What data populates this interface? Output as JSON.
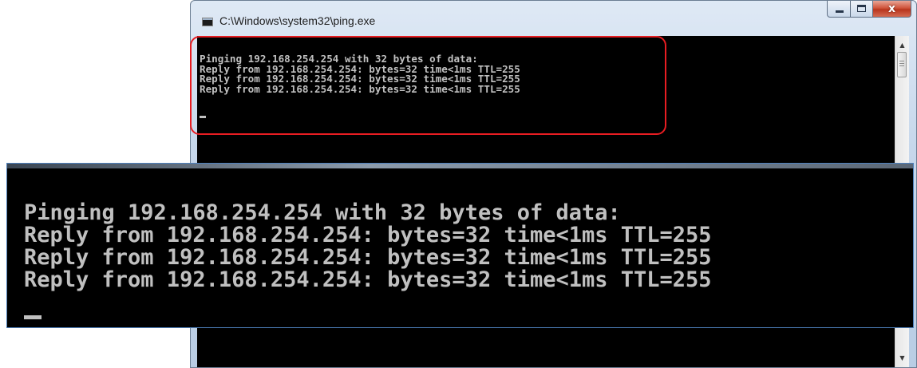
{
  "window": {
    "title": "C:\\Windows\\system32\\ping.exe",
    "close_glyph": "x",
    "buttons": [
      "minimize",
      "maximize",
      "close"
    ]
  },
  "console": {
    "lines": [
      "Pinging 192.168.254.254 with 32 bytes of data:",
      "Reply from 192.168.254.254: bytes=32 time<1ms TTL=255",
      "Reply from 192.168.254.254: bytes=32 time<1ms TTL=255",
      "Reply from 192.168.254.254: bytes=32 time<1ms TTL=255"
    ]
  },
  "zoom": {
    "lines": [
      "Pinging 192.168.254.254 with 32 bytes of data:",
      "Reply from 192.168.254.254: bytes=32 time<1ms TTL=255",
      "Reply from 192.168.254.254: bytes=32 time<1ms TTL=255",
      "Reply from 192.168.254.254: bytes=32 time<1ms TTL=255"
    ]
  },
  "colors": {
    "console_text": "#c0c0c0",
    "console_bg": "#000000",
    "highlight": "#e81d22",
    "zoom_border": "#4f81bd"
  },
  "icons": {
    "app": "console-app-icon",
    "scroll_up": "scroll-up-icon",
    "scroll_down": "scroll-down-icon"
  }
}
